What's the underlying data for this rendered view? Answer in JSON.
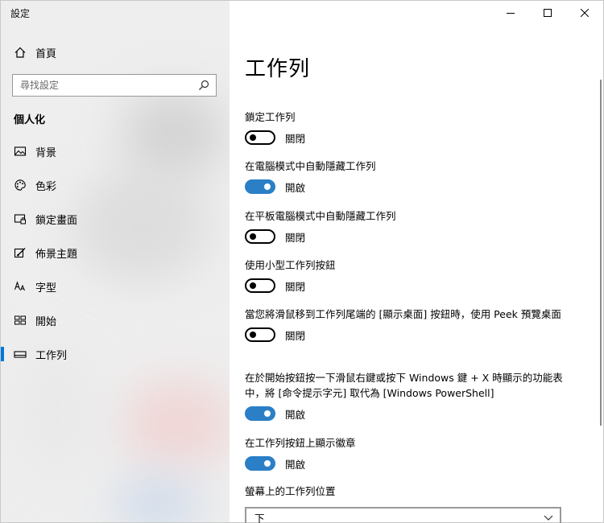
{
  "window": {
    "title": "設定",
    "controls": {
      "minimize": "minimize-icon",
      "maximize": "maximize-icon",
      "close": "close-icon"
    }
  },
  "sidebar": {
    "home_label": "首頁",
    "search": {
      "placeholder": "尋找設定"
    },
    "section_title": "個人化",
    "items": [
      {
        "label": "背景",
        "icon": "picture-icon"
      },
      {
        "label": "色彩",
        "icon": "palette-icon"
      },
      {
        "label": "鎖定畫面",
        "icon": "lock-screen-icon"
      },
      {
        "label": "佈景主題",
        "icon": "theme-brush-icon"
      },
      {
        "label": "字型",
        "icon": "font-icon"
      },
      {
        "label": "開始",
        "icon": "start-icon"
      },
      {
        "label": "工作列",
        "icon": "taskbar-icon",
        "selected": true
      }
    ]
  },
  "main": {
    "title": "工作列",
    "settings": [
      {
        "label": "鎖定工作列",
        "state": "關閉",
        "on": false
      },
      {
        "label": "在電腦模式中自動隱藏工作列",
        "state": "開啟",
        "on": true
      },
      {
        "label": "在平板電腦模式中自動隱藏工作列",
        "state": "關閉",
        "on": false
      },
      {
        "label": "使用小型工作列按鈕",
        "state": "關閉",
        "on": false
      },
      {
        "label": "當您將滑鼠移到工作列尾端的 [顯示桌面] 按鈕時，使用 Peek 預覽桌面",
        "state": "關閉",
        "on": false
      },
      {
        "label": "在於開始按鈕按一下滑鼠右鍵或按下 Windows 鍵 + X 時顯示的功能表中，將 [命令提示字元] 取代為 [Windows PowerShell]",
        "state": "開啟",
        "on": true
      },
      {
        "label": "在工作列按鈕上顯示徽章",
        "state": "開啟",
        "on": true
      }
    ],
    "position": {
      "label": "螢幕上的工作列位置",
      "value": "下"
    }
  },
  "colors": {
    "accent": "#2a7fc7",
    "selection_bar": "#0078d7",
    "sidebar_bg": "#eeeeee"
  }
}
